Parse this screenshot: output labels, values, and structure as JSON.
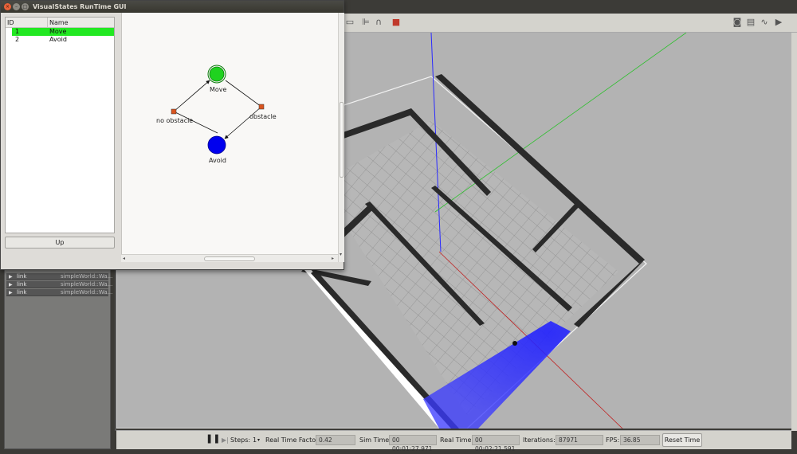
{
  "visualstates": {
    "title": "VisualStates RunTime GUI",
    "list_headers": {
      "id": "ID",
      "name": "Name"
    },
    "states": [
      {
        "id": "1",
        "name": "Move",
        "active": true
      },
      {
        "id": "2",
        "name": "Avoid",
        "active": false
      }
    ],
    "up_button": "Up",
    "diagram": {
      "move_label": "Move",
      "avoid_label": "Avoid",
      "transition_no_obstacle": "no obstacle",
      "transition_obstacle": "obstacle",
      "active_color": "#1fd21f",
      "inactive_color": "#0000ee"
    }
  },
  "gazebo": {
    "links": [
      {
        "name": "link",
        "value": "simpleWorld::Wa..."
      },
      {
        "name": "link",
        "value": "simpleWorld::Wa..."
      },
      {
        "name": "link",
        "value": "simpleWorld::Wa..."
      }
    ],
    "status": {
      "steps_label": "Steps:",
      "steps_value": "1",
      "rtf_label": "Real Time Factor:",
      "rtf_value": "0.42",
      "sim_time_label": "Sim Time:",
      "sim_time_value": "00 00:01:27.971",
      "real_time_label": "Real Time:",
      "real_time_value": "00 00:02:21.591",
      "iterations_label": "Iterations:",
      "iterations_value": "87971",
      "fps_label": "FPS:",
      "fps_value": "36.85",
      "reset_button": "Reset Time"
    }
  }
}
